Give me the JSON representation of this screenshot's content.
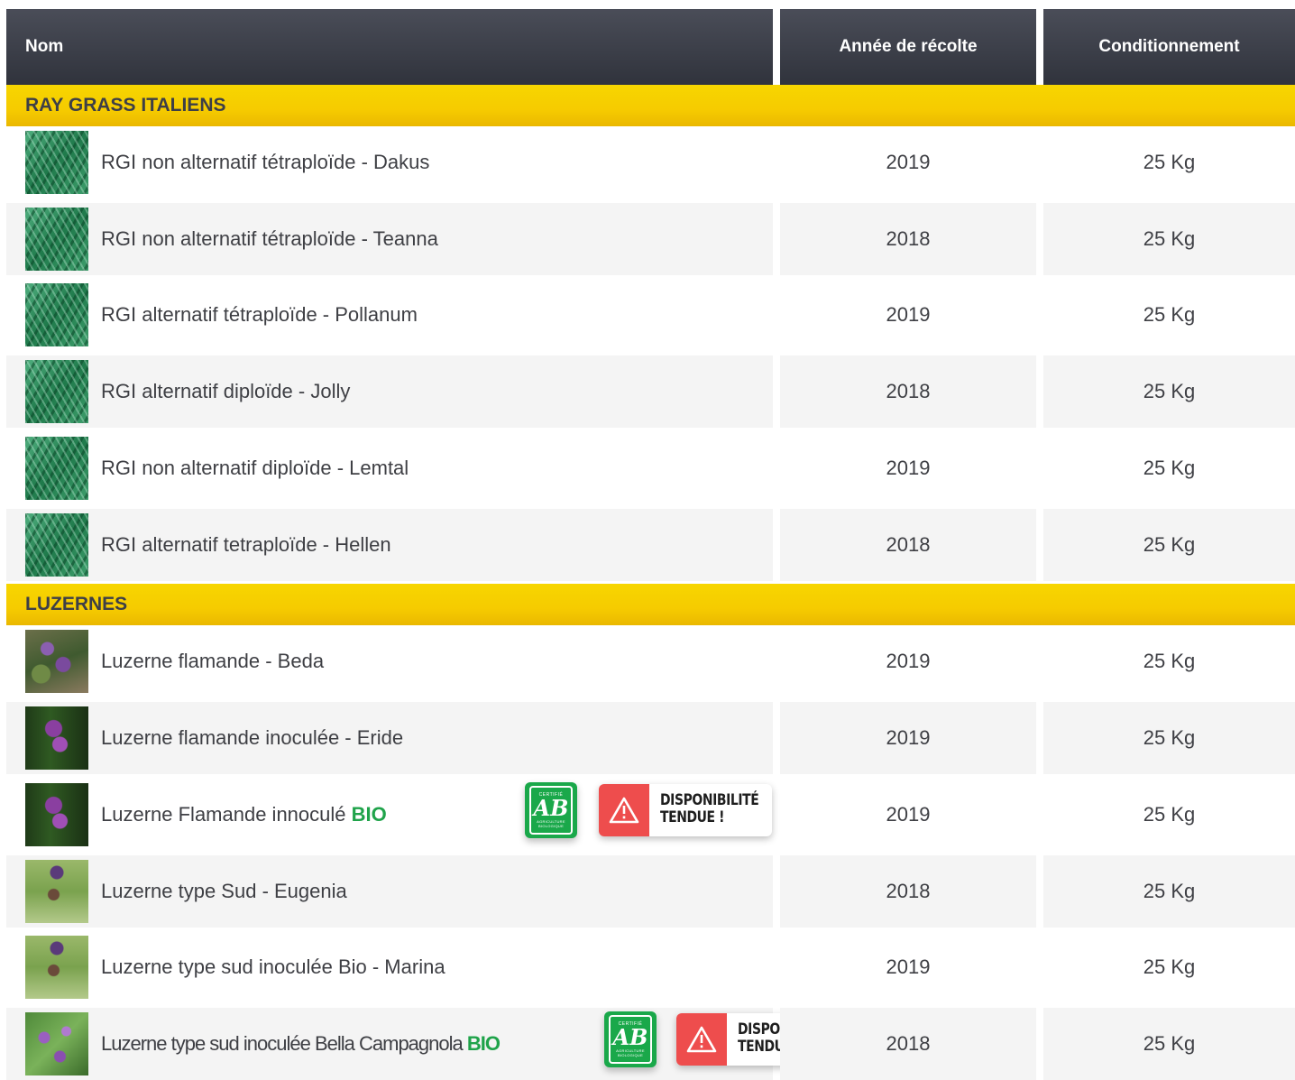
{
  "headers": {
    "name": "Nom",
    "year": "Année de récolte",
    "pack": "Conditionnement"
  },
  "categories": [
    {
      "title": "RAY GRASS ITALIENS",
      "rows": [
        {
          "name": "RGI non alternatif tétraploïde - Dakus",
          "year": "2019",
          "pack": "25 Kg",
          "thumb": "ryegrass-photo"
        },
        {
          "name": "RGI non alternatif tétraploïde - Teanna",
          "year": "2018",
          "pack": "25 Kg",
          "thumb": "ryegrass-photo"
        },
        {
          "name": "RGI alternatif tétraploïde - Pollanum",
          "year": "2019",
          "pack": "25 Kg",
          "thumb": "ryegrass-photo"
        },
        {
          "name": "RGI alternatif diploïde - Jolly",
          "year": "2018",
          "pack": "25 Kg",
          "thumb": "ryegrass-photo"
        },
        {
          "name": "RGI non alternatif diploïde - Lemtal",
          "year": "2019",
          "pack": "25 Kg",
          "thumb": "ryegrass-photo"
        },
        {
          "name": "RGI alternatif tetraploïde - Hellen",
          "year": "2018",
          "pack": "25 Kg",
          "thumb": "ryegrass-photo"
        }
      ]
    },
    {
      "title": "LUZERNES",
      "rows": [
        {
          "name": "Luzerne flamande - Beda",
          "year": "2019",
          "pack": "25 Kg",
          "thumb": "alfalfa-photo"
        },
        {
          "name": "Luzerne flamande inoculée - Eride",
          "year": "2019",
          "pack": "25 Kg",
          "thumb": "alfalfa-flower-photo"
        },
        {
          "name": "Luzerne Flamande innoculé",
          "bio": "BIO",
          "year": "2019",
          "pack": "25 Kg",
          "thumb": "alfalfa-flower-photo",
          "ab_badge": {
            "top": "CERTIFIÉ",
            "letters": "AB",
            "bottom": "AGRICULTURE BIOLOGIQUE"
          },
          "warning": {
            "line1": "DISPONIBILITÉ",
            "line2": "TENDUE !"
          }
        },
        {
          "name": "Luzerne type Sud - Eugenia",
          "year": "2018",
          "pack": "25 Kg",
          "thumb": "alfalfa-south-photo"
        },
        {
          "name": "Luzerne type sud inoculée Bio - Marina",
          "year": "2019",
          "pack": "25 Kg",
          "thumb": "alfalfa-south-photo"
        },
        {
          "name": "Luzerne type sud inoculée Bella Campagnola",
          "bio": "BIO",
          "year": "2018",
          "pack": "25 Kg",
          "thumb": "alfalfa-field-photo",
          "ab_badge": {
            "top": "CERTIFIÉ",
            "letters": "AB",
            "bottom": "AGRICULTURE BIOLOGIQUE"
          },
          "warning": {
            "line1": "DISPONIBILITÉ",
            "line2": "TENDUE !"
          }
        }
      ]
    }
  ],
  "colors": {
    "header_bg": "#3a3d46",
    "category_bg": "#f6cb00",
    "bio_green": "#1fa34a",
    "warning_red": "#ee4d4d"
  }
}
